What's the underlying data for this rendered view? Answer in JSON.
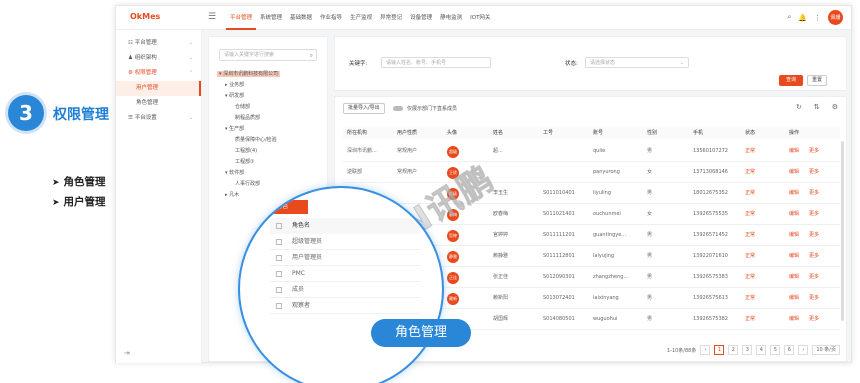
{
  "promo": {
    "step_number": "3",
    "step_title": "权限管理",
    "bullets": [
      "角色管理",
      "用户管理"
    ],
    "bullet_marker": "➤",
    "lens_label": "角色管理",
    "watermark": "SUNPN讯鹏"
  },
  "app": {
    "logo": "OkMes",
    "menu_icon": "☰",
    "top_nav": [
      "平台管理",
      "系统管理",
      "基础数据",
      "作业指导",
      "生产监视",
      "异常登记",
      "设备管理",
      "静电监测",
      "IOT网关"
    ],
    "active_nav_index": 0,
    "top_icons": [
      "⌕",
      "🔔",
      "⋮"
    ],
    "user_avatar": "佩珊",
    "sidebar": [
      {
        "label": "平台管理",
        "icon": "☷",
        "chev": "⌄"
      },
      {
        "label": "组织架构",
        "icon": "♟",
        "chev": "⌄"
      },
      {
        "label": "权限管理",
        "icon": "⚙",
        "chev": "⌃"
      },
      {
        "label": "用户管理",
        "sub": true,
        "active": true
      },
      {
        "label": "角色管理",
        "sub": true
      },
      {
        "label": "平台设置",
        "icon": "☰",
        "chev": "⌄"
      }
    ],
    "sidebar_footer": "⇥",
    "tree": {
      "search_placeholder": "请输入关键字进行搜索",
      "search_icon": "⌕",
      "nodes": [
        "▾ 深圳市讯鹏科技有限公司",
        "▸ 业务部",
        "▾ 研发部",
        "仓储部",
        "制程品质部",
        "▾ 生产部",
        "质量保障中心/检验",
        "工程部(4)",
        "工程部①",
        "▾ 软件部",
        "人事行政部",
        "▸ 凡木"
      ],
      "selected_index": 0
    },
    "filter": {
      "keyword_label": "关键字:",
      "keyword_placeholder": "请输入姓名、账号、手机号",
      "status_label": "状态:",
      "status_placeholder": "请选择状态",
      "query_button": "查询",
      "reset_button": "重置"
    },
    "table": {
      "import_export": "批量导入/导出",
      "toggle_label": "仅展示部门下直系成员",
      "tool_icons": [
        "↻",
        "⇅",
        "⚙"
      ],
      "columns": [
        "所在机构",
        "用户性质",
        "头像",
        "姓名",
        "工号",
        "账号",
        "性别",
        "手机",
        "状态",
        "操作"
      ],
      "rows": [
        [
          "深圳市讯鹏...",
          "常规用户",
          "超级",
          "超...",
          "",
          "quile",
          "男",
          "13560107272",
          "正常",
          "编辑",
          "更多"
        ],
        [
          "逆联部",
          "常规用户",
          "王欣",
          "",
          "",
          "panyurong",
          "女",
          "13713068146",
          "正常",
          "编辑",
          "更多"
        ],
        [
          "",
          "",
          "超级",
          "李玉生",
          "S011010401",
          "liyuling",
          "男",
          "18012675352",
          "正常",
          "编辑",
          "更多"
        ],
        [
          "",
          "",
          "春梅",
          "欧春梅",
          "S011021401",
          "ouchunmei",
          "女",
          "13926575535",
          "正常",
          "编辑",
          "更多"
        ],
        [
          "",
          "",
          "官婷",
          "官婷婷",
          "S011111201",
          "guantingye...",
          "男",
          "13926571452",
          "正常",
          "编辑",
          "更多"
        ],
        [
          "",
          "",
          "静雅",
          "赖静雅",
          "S011112801",
          "laiyujing",
          "男",
          "13922071610",
          "正常",
          "编辑",
          "更多"
        ],
        [
          "",
          "",
          "正佳",
          "张正佳",
          "S012090301",
          "zhangzheng...",
          "男",
          "13926575383",
          "正常",
          "编辑",
          "更多"
        ],
        [
          "",
          "",
          "赖新",
          "赖新阳",
          "S013072401",
          "laixinyang",
          "男",
          "13926575613",
          "正常",
          "编辑",
          "更多"
        ],
        [
          "",
          "",
          "",
          "胡国辉",
          "S014080501",
          "wuguohui",
          "男",
          "13926575382",
          "正常",
          "编辑",
          "更多"
        ]
      ],
      "pagination": {
        "summary": "1-10条/88条",
        "prev": "‹",
        "pages": [
          "1",
          "2",
          "3",
          "4",
          "5",
          "6"
        ],
        "current_page": "1",
        "next": "›",
        "page_size": "10 条/页"
      }
    },
    "lens": {
      "tab": "新增角色",
      "header": "角色名",
      "rows": [
        "超级管理员",
        "用户管理员",
        "PMC",
        "成员",
        "观察者"
      ]
    }
  }
}
